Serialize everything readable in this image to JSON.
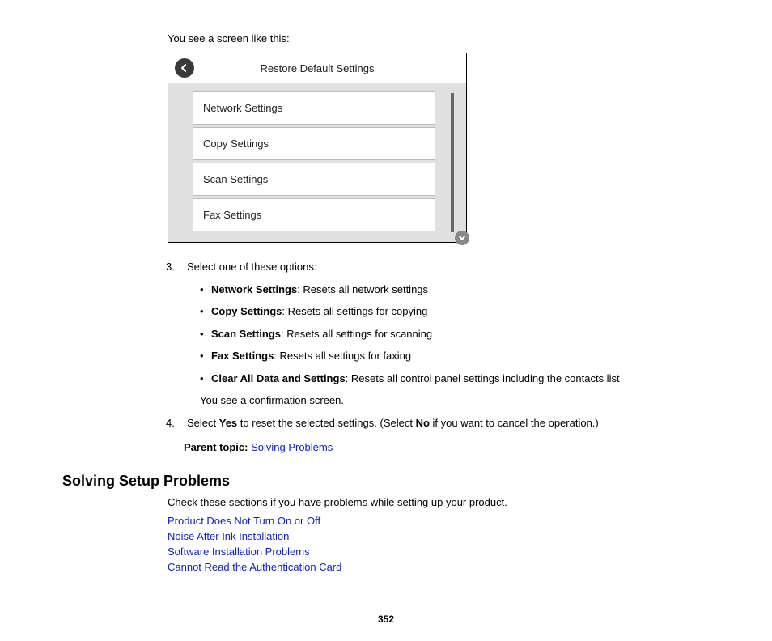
{
  "intro": "You see a screen like this:",
  "device": {
    "title": "Restore Default Settings",
    "items": [
      "Network Settings",
      "Copy Settings",
      "Scan Settings",
      "Fax Settings"
    ]
  },
  "step3": {
    "lead": "Select one of these options:",
    "options": [
      {
        "label": "Network Settings",
        "desc": ": Resets all network settings"
      },
      {
        "label": "Copy Settings",
        "desc": ": Resets all settings for copying"
      },
      {
        "label": "Scan Settings",
        "desc": ": Resets all settings for scanning"
      },
      {
        "label": "Fax Settings",
        "desc": ": Resets all settings for faxing"
      },
      {
        "label": "Clear All Data and Settings",
        "desc": ": Resets all control panel settings including the contacts list"
      }
    ],
    "followup": "You see a confirmation screen."
  },
  "step4": {
    "pre": "Select ",
    "yes": "Yes",
    "mid": " to reset the selected settings. (Select ",
    "no": "No",
    "post": " if you want to cancel the operation.)"
  },
  "parent": {
    "label": "Parent topic: ",
    "link": "Solving Problems"
  },
  "section": {
    "heading": "Solving Setup Problems",
    "intro": "Check these sections if you have problems while setting up your product.",
    "links": [
      "Product Does Not Turn On or Off",
      "Noise After Ink Installation",
      "Software Installation Problems",
      "Cannot Read the Authentication Card"
    ]
  },
  "pageNumber": "352"
}
